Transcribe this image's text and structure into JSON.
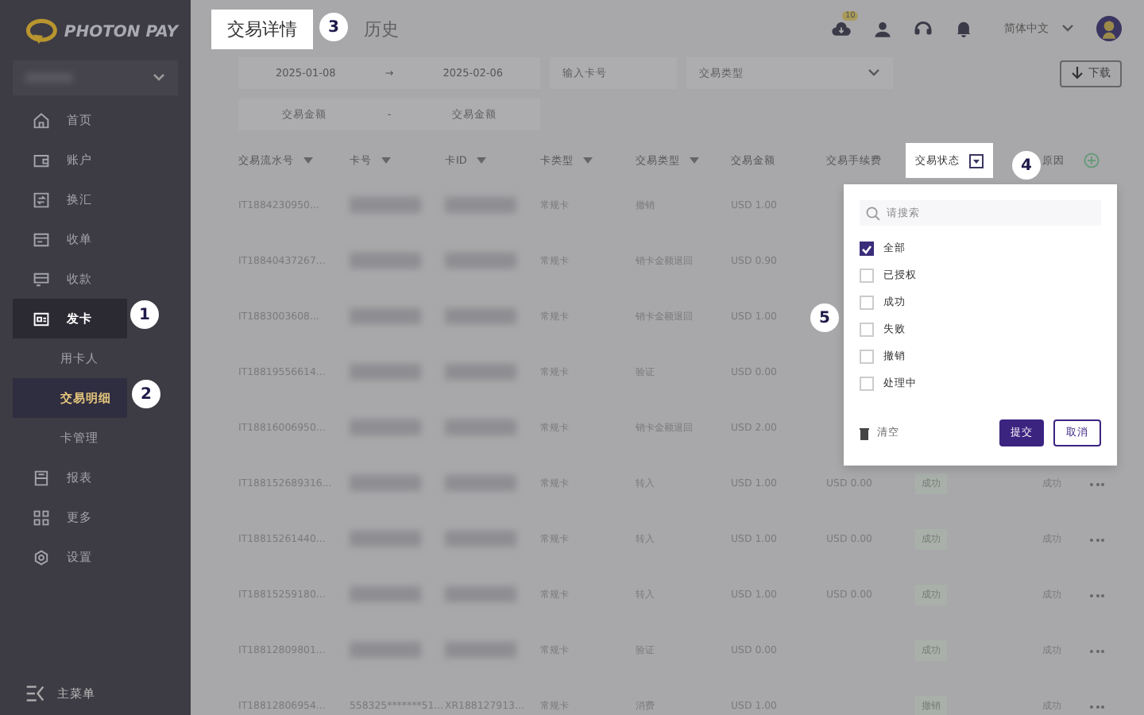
{
  "sidebar": {
    "logo_text": "PHOTON PAY",
    "nav": [
      {
        "label": "首页",
        "selected": false
      },
      {
        "label": "账户",
        "selected": false
      },
      {
        "label": "换汇",
        "selected": false
      },
      {
        "label": "收单",
        "selected": false
      },
      {
        "label": "收款",
        "selected": false
      },
      {
        "label": "发卡",
        "selected": true,
        "children": [
          {
            "label": "用卡人",
            "selected": false
          },
          {
            "label": "交易明细",
            "selected": true
          },
          {
            "label": "卡管理",
            "selected": false
          }
        ]
      },
      {
        "label": "报表",
        "selected": false
      },
      {
        "label": "更多",
        "selected": false
      },
      {
        "label": "设置",
        "selected": false
      }
    ],
    "footer": "主菜单"
  },
  "header": {
    "tabs": [
      {
        "label": "交易详情",
        "selected": true
      },
      {
        "label": "历史",
        "selected": false
      }
    ],
    "download_badge": "10",
    "language": "简体中文"
  },
  "filters": {
    "date_start": "2025-01-08",
    "date_sep": "→",
    "date_end": "2025-02-06",
    "card_placeholder": "输入卡号",
    "type_placeholder": "交易类型",
    "download": "下载",
    "amount_min_placeholder": "交易金额",
    "amount_sep": "-",
    "amount_max_placeholder": "交易金额"
  },
  "table": {
    "columns": [
      {
        "label": "交易流水号",
        "kind": "sort"
      },
      {
        "label": "卡号",
        "kind": "sort"
      },
      {
        "label": "卡ID",
        "kind": "sort"
      },
      {
        "label": "卡类型",
        "kind": "sort"
      },
      {
        "label": "交易类型",
        "kind": "sort"
      },
      {
        "label": "交易金额",
        "kind": "plain"
      },
      {
        "label": "交易手续费",
        "kind": "plain"
      },
      {
        "label": "交易状态",
        "kind": "filter"
      },
      {
        "label": "原因",
        "kind": "plain"
      }
    ],
    "rows": [
      {
        "id": "IT1884230950...",
        "card_type": "常规卡",
        "type": "撤销",
        "amount": "USD 1.00"
      },
      {
        "id": "IT18840437267...",
        "card_type": "常规卡",
        "type": "销卡金额退回",
        "amount": "USD 0.90"
      },
      {
        "id": "IT1883003608...",
        "card_type": "常规卡",
        "type": "销卡金额退回",
        "amount": "USD 1.00"
      },
      {
        "id": "IT18819556614...",
        "card_type": "常规卡",
        "type": "验证",
        "amount": "USD 0.00"
      },
      {
        "id": "IT18816006950...",
        "card_type": "常规卡",
        "type": "销卡金额退回",
        "amount": "USD 2.00"
      },
      {
        "id": "IT188152689316...",
        "card_type": "常规卡",
        "type": "转入",
        "amount": "USD 1.00",
        "fee": "USD 0.00",
        "status": "成功",
        "reason": "成功"
      },
      {
        "id": "IT18815261440...",
        "card_type": "常规卡",
        "type": "转入",
        "amount": "USD 1.00",
        "fee": "USD 0.00",
        "status": "成功",
        "reason": "成功"
      },
      {
        "id": "IT18815259180...",
        "card_type": "常规卡",
        "type": "转入",
        "amount": "USD 1.00",
        "fee": "USD 0.00",
        "status": "成功",
        "reason": "成功"
      },
      {
        "id": "IT18812809801...",
        "card_type": "常规卡",
        "type": "验证",
        "amount": "USD 0.00",
        "status": "成功",
        "reason": "成功"
      },
      {
        "id": "IT18812806954...",
        "card_number": "558325*******51...",
        "card_id": "XR188127913...",
        "card_type": "常规卡",
        "type": "消费",
        "amount": "USD 1.00",
        "status": "撤销",
        "reason": "成功"
      }
    ]
  },
  "status_filter": {
    "search_placeholder": "请搜索",
    "options": [
      {
        "label": "全部",
        "checked": true
      },
      {
        "label": "已授权",
        "checked": false
      },
      {
        "label": "成功",
        "checked": false
      },
      {
        "label": "失败",
        "checked": false
      },
      {
        "label": "撤销",
        "checked": false
      },
      {
        "label": "处理中",
        "checked": false
      }
    ],
    "clear": "清空",
    "submit": "提交",
    "cancel": "取消"
  },
  "callouts": [
    "1",
    "2",
    "3",
    "4",
    "5"
  ]
}
